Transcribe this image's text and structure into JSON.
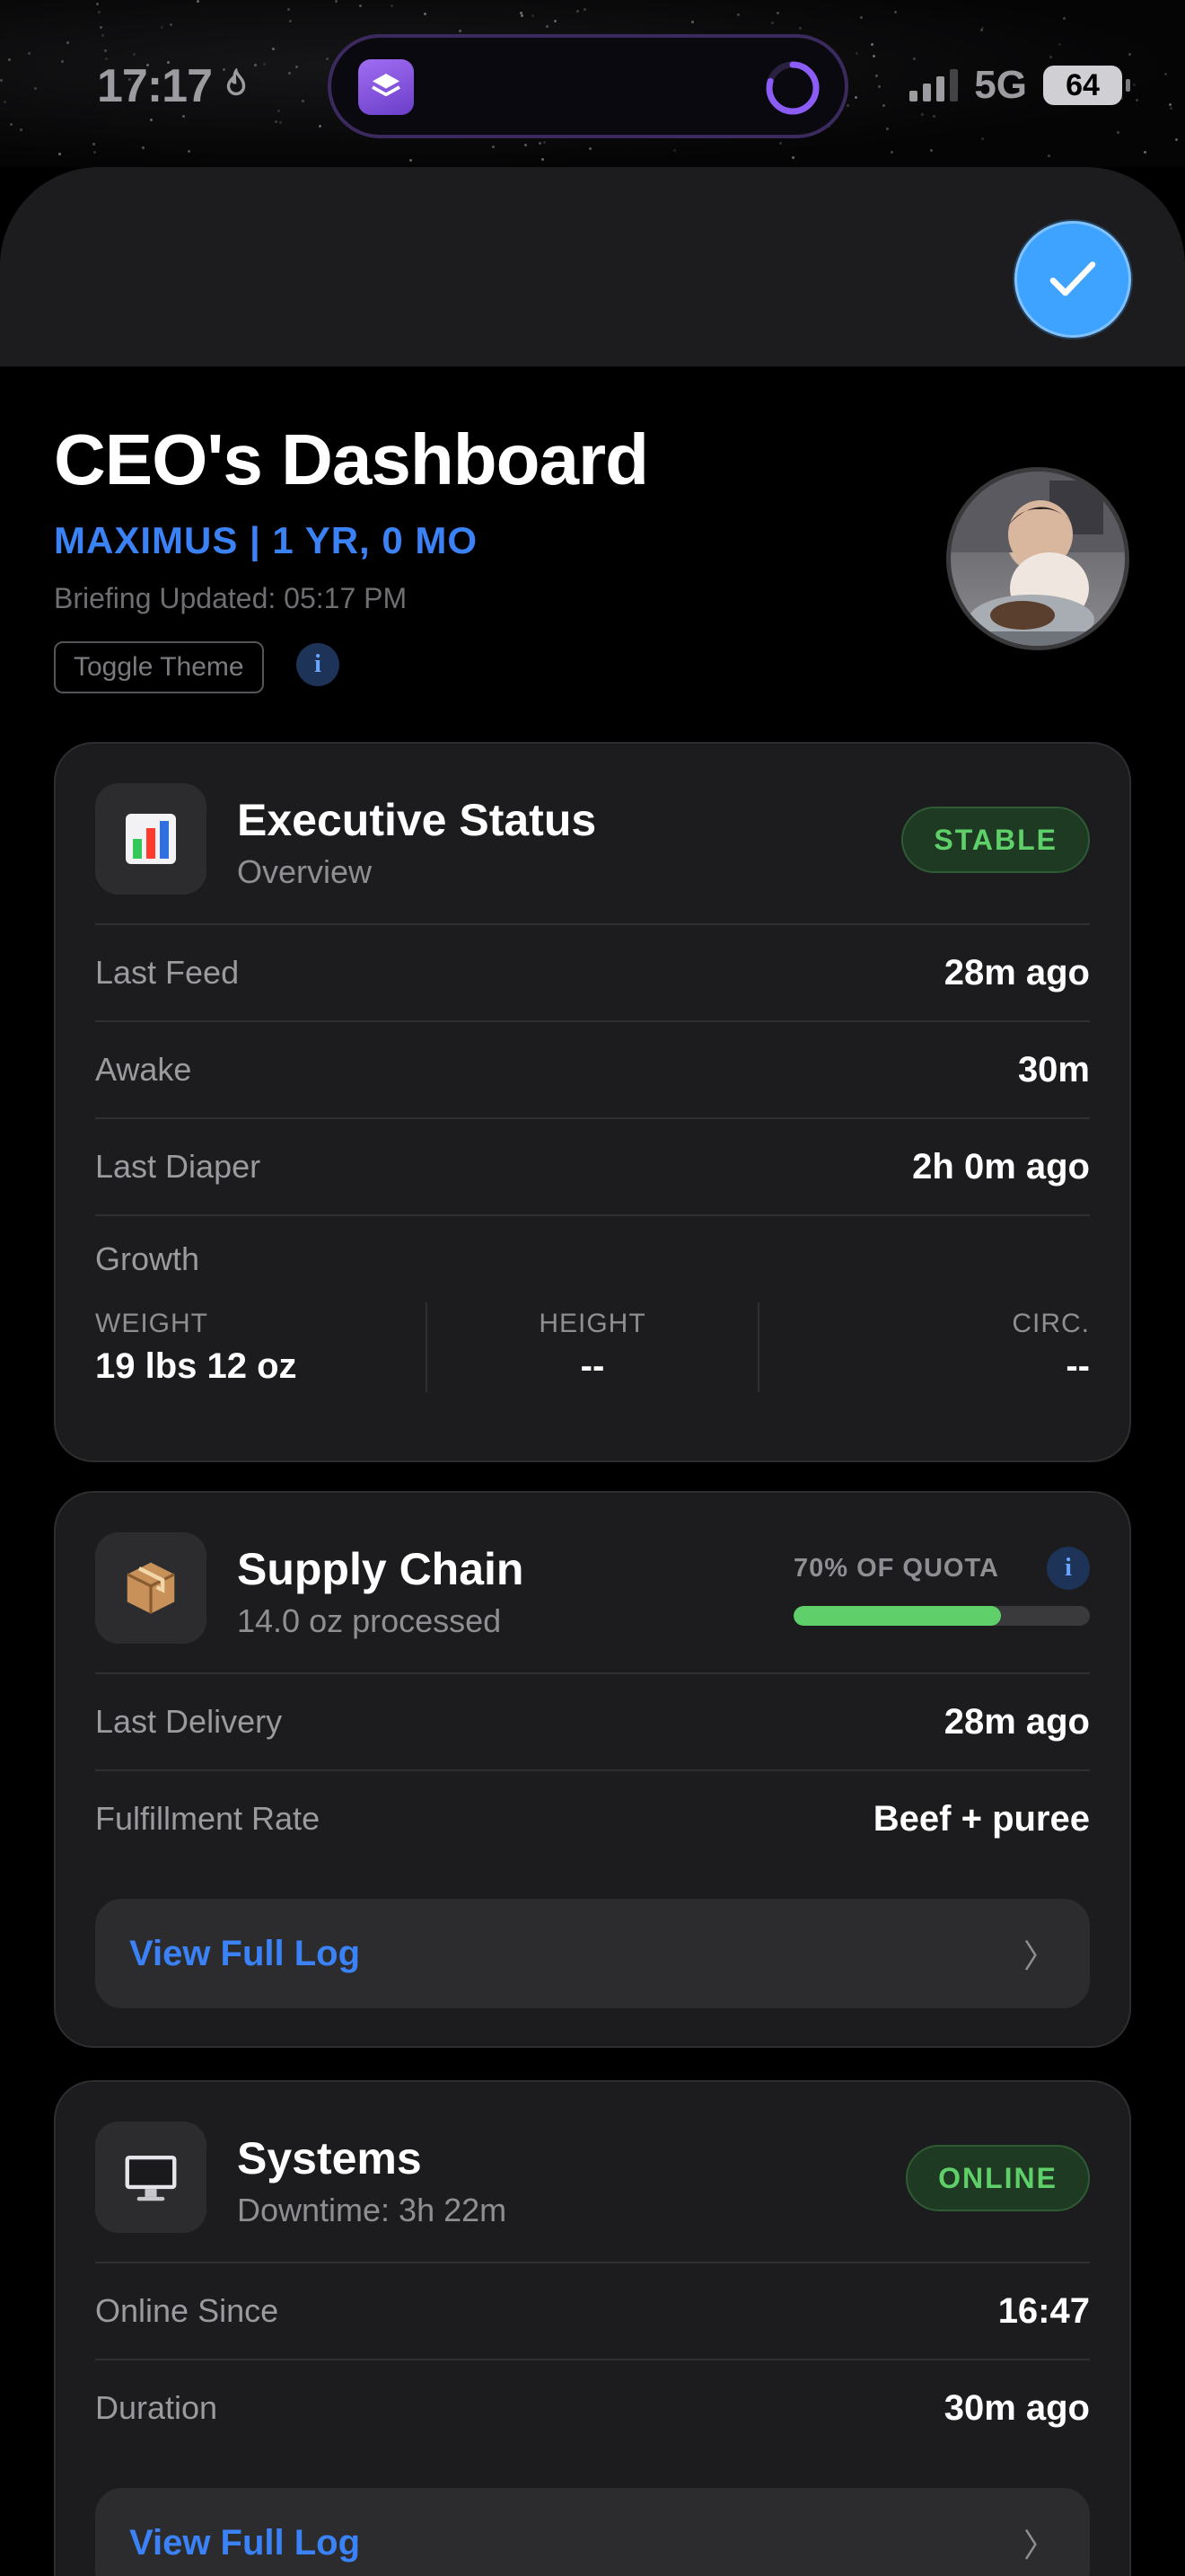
{
  "status_bar": {
    "time": "17:17",
    "network": "5G",
    "battery": "64"
  },
  "header": {
    "title": "CEO's Dashboard",
    "subtitle": "MAXIMUS | 1 YR, 0 MO",
    "updated": "Briefing Updated: 05:17 PM",
    "toggle_label": "Toggle Theme",
    "info_label": "i"
  },
  "executive": {
    "icon": "chart-icon",
    "title": "Executive Status",
    "subtitle": "Overview",
    "badge": "STABLE",
    "rows": [
      {
        "label": "Last Feed",
        "value": "28m ago"
      },
      {
        "label": "Awake",
        "value": "30m"
      },
      {
        "label": "Last Diaper",
        "value": "2h 0m ago"
      }
    ],
    "growth_label": "Growth",
    "growth": [
      {
        "label": "WEIGHT",
        "value": "19 lbs 12 oz"
      },
      {
        "label": "HEIGHT",
        "value": "--"
      },
      {
        "label": "CIRC.",
        "value": "--"
      }
    ]
  },
  "supply": {
    "icon": "package-icon",
    "title": "Supply Chain",
    "subtitle": "14.0 oz processed",
    "quota_label": "70% OF QUOTA",
    "quota_fraction": 0.7,
    "info_label": "i",
    "rows": [
      {
        "label": "Last Delivery",
        "value": "28m ago"
      },
      {
        "label": "Fulfillment Rate",
        "value": "Beef + puree"
      }
    ],
    "log_label": "View Full Log",
    "chevron": "〉"
  },
  "systems": {
    "icon": "computer-icon",
    "title": "Systems",
    "subtitle": "Downtime: 3h 22m",
    "badge": "ONLINE",
    "rows": [
      {
        "label": "Online Since",
        "value": "16:47"
      },
      {
        "label": "Duration",
        "value": "30m ago"
      }
    ],
    "log_label": "View Full Log",
    "chevron": "〉"
  },
  "colors": {
    "accent": "#3a82f6",
    "success": "#5fd069",
    "card": "#1c1c1e",
    "done": "#3ea2ff"
  }
}
